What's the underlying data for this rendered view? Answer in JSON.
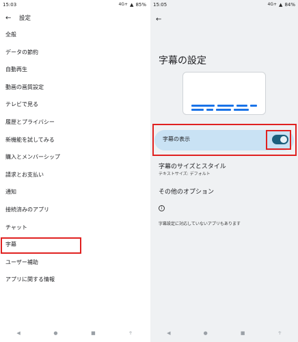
{
  "left": {
    "status": {
      "time": "15:03",
      "icons_text": "4G+",
      "battery": "85%"
    },
    "appbar": {
      "title": "設定"
    },
    "menu": [
      {
        "label": "全般"
      },
      {
        "label": "データの節約"
      },
      {
        "label": "自動再生"
      },
      {
        "label": "動画の画質設定"
      },
      {
        "label": "テレビで見る"
      },
      {
        "label": "履歴とプライバシー"
      },
      {
        "label": "新機能を試してみる"
      },
      {
        "label": "購入とメンバーシップ"
      },
      {
        "label": "請求とお支払い"
      },
      {
        "label": "通知"
      },
      {
        "label": "接続済みのアプリ"
      },
      {
        "label": "チャット"
      },
      {
        "label": "字幕"
      },
      {
        "label": "ユーザー補助"
      },
      {
        "label": "アプリに関する情報"
      }
    ]
  },
  "right": {
    "status": {
      "time": "15:05",
      "icons_text": "4G+",
      "battery": "84%"
    },
    "title": "字幕の設定",
    "toggle": {
      "label": "字幕の表示",
      "state": "on"
    },
    "size_style": {
      "title": "字幕のサイズとスタイル",
      "subtitle": "テキストサイズ: デフォルト"
    },
    "other": {
      "title": "その他のオプション"
    },
    "note": "字幕設定に対応していないアプリもあります"
  },
  "colors": {
    "highlight": "#e0201f",
    "accent": "#1a73e8",
    "toggle_bg": "#c9e2f4",
    "switch": "#1c5f7d"
  }
}
